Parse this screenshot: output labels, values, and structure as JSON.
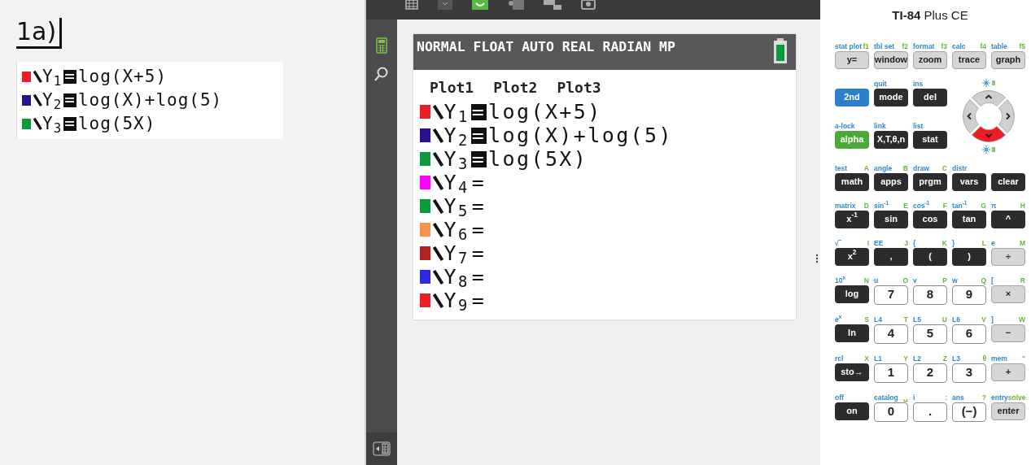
{
  "notes": {
    "heading": "1a)",
    "equations": [
      {
        "color": "#ee1c24",
        "label": "Y$_{1}$",
        "equals": "=",
        "selected": true,
        "expression": "log(X+5)"
      },
      {
        "color": "#2a0f90",
        "label": "Y$_{2}$",
        "equals": "=",
        "selected": true,
        "expression": "log(X)+log(5)"
      },
      {
        "color": "#0b9a3b",
        "label": "Y$_{3}$",
        "equals": "=",
        "selected": true,
        "expression": "log(5X)"
      }
    ]
  },
  "screen": {
    "status": "NORMAL FLOAT AUTO REAL RADIAN MP",
    "plots": [
      "Plot1",
      "Plot2",
      "Plot3"
    ],
    "functions": [
      {
        "color": "#ee1c24",
        "label": "Y$_{1}$",
        "equals": "=",
        "selected": true,
        "expression": "log(X+5)"
      },
      {
        "color": "#2a0f90",
        "label": "Y$_{2}$",
        "equals": "=",
        "selected": true,
        "expression": "log(X)+log(5)"
      },
      {
        "color": "#0b9a3b",
        "label": "Y$_{3}$",
        "equals": "=",
        "selected": true,
        "expression": "log(5X)"
      },
      {
        "color": "#ff00ff",
        "label": "Y$_{4}$",
        "equals": "=",
        "selected": false
      },
      {
        "color": "#0b9a3b",
        "label": "Y$_{5}$",
        "equals": "=",
        "selected": false
      },
      {
        "color": "#f7924a",
        "label": "Y$_{6}$",
        "equals": "=",
        "selected": false
      },
      {
        "color": "#b22222",
        "label": "Y$_{7}$",
        "equals": "=",
        "selected": false
      },
      {
        "color": "#2a2ae0",
        "label": "Y$_{8}$",
        "equals": "=",
        "selected": false
      },
      {
        "color": "#ee1c24",
        "label": "Y$_{9}$",
        "equals": "=",
        "selected": false
      }
    ]
  },
  "keypad": {
    "title": "**TI-84** Plus CE",
    "dpad": [
      {
        "kind": "up",
        "pressed": false
      },
      {
        "kind": "left",
        "pressed": false
      },
      {
        "kind": "right",
        "pressed": false
      },
      {
        "kind": "down",
        "pressed": true
      }
    ],
    "keys": [
      {
        "second": "stat plot",
        "alpha": "f1",
        "label": "y=",
        "kind": "gray"
      },
      {
        "second": "tbl set",
        "alpha": "f2",
        "label": "window",
        "kind": "gray"
      },
      {
        "second": "format",
        "alpha": "f3",
        "label": "zoom",
        "kind": "gray"
      },
      {
        "second": "calc",
        "alpha": "f4",
        "label": "trace",
        "kind": "gray"
      },
      {
        "second": "table",
        "alpha": "f5",
        "label": "graph",
        "kind": "gray"
      },
      {
        "label": "2nd",
        "kind": "blue"
      },
      {
        "second": "quit",
        "label": "mode",
        "kind": "dark"
      },
      {
        "second": "ins",
        "label": "del",
        "kind": "dark"
      },
      {
        "second": "a-lock",
        "label": "alpha",
        "kind": "green"
      },
      {
        "second": "link",
        "label": "X,T,θ,n",
        "kind": "dark"
      },
      {
        "second": "list",
        "label": "stat",
        "kind": "dark"
      },
      {
        "second": "test",
        "alpha": "A",
        "label": "math",
        "kind": "dark"
      },
      {
        "second": "angle",
        "alpha": "B",
        "label": "apps",
        "kind": "dark"
      },
      {
        "second": "draw",
        "alpha": "C",
        "label": "prgm",
        "kind": "dark"
      },
      {
        "second": "distr",
        "label": "vars",
        "kind": "dark"
      },
      {
        "label": "clear",
        "kind": "dark"
      },
      {
        "second": "matrix",
        "alpha": "D",
        "label": "x$^{-1}$",
        "kind": "dark"
      },
      {
        "second": "sin$^{-1}$",
        "alpha": "E",
        "label": "sin",
        "kind": "dark"
      },
      {
        "second": "cos$^{-1}$",
        "alpha": "F",
        "label": "cos",
        "kind": "dark"
      },
      {
        "second": "tan$^{-1}$",
        "alpha": "G",
        "label": "tan",
        "kind": "dark"
      },
      {
        "second": "π",
        "alpha": "H",
        "label": "^",
        "kind": "dark"
      },
      {
        "second": "√‾",
        "alpha": "I",
        "label": "x$^{2}$",
        "kind": "dark"
      },
      {
        "second": "EE",
        "alpha": "J",
        "label": ",",
        "kind": "dark"
      },
      {
        "second": "{",
        "alpha": "K",
        "label": "(",
        "kind": "dark"
      },
      {
        "second": "}",
        "alpha": "L",
        "label": ")",
        "kind": "dark"
      },
      {
        "second": "e",
        "alpha": "M",
        "label": "÷",
        "kind": "gray"
      },
      {
        "second": "10$^{x}$",
        "alpha": "N",
        "label": "log",
        "kind": "dark"
      },
      {
        "second": "u",
        "alpha": "O",
        "label": "7",
        "kind": "white"
      },
      {
        "second": "v",
        "alpha": "P",
        "label": "8",
        "kind": "white"
      },
      {
        "second": "w",
        "alpha": "Q",
        "label": "9",
        "kind": "white"
      },
      {
        "second": "[",
        "alpha": "R",
        "label": "×",
        "kind": "gray"
      },
      {
        "second": "e$^{x}$",
        "alpha": "S",
        "label": "ln",
        "kind": "dark"
      },
      {
        "second": "L4",
        "alpha": "T",
        "label": "4",
        "kind": "white"
      },
      {
        "second": "L5",
        "alpha": "U",
        "label": "5",
        "kind": "white"
      },
      {
        "second": "L6",
        "alpha": "V",
        "label": "6",
        "kind": "white"
      },
      {
        "second": "]",
        "alpha": "W",
        "label": "−",
        "kind": "gray"
      },
      {
        "second": "rcl",
        "alpha": "X",
        "label": "sto→",
        "kind": "dark"
      },
      {
        "second": "L1",
        "alpha": "Y",
        "label": "1",
        "kind": "white"
      },
      {
        "second": "L2",
        "alpha": "Z",
        "label": "2",
        "kind": "white"
      },
      {
        "second": "L3",
        "alpha": "θ",
        "label": "3",
        "kind": "white"
      },
      {
        "second": "mem",
        "alpha": "\"",
        "label": "+",
        "kind": "gray"
      },
      {
        "second": "off",
        "label": "on",
        "kind": "dark"
      },
      {
        "second": "catalog",
        "alpha": "␣",
        "label": "0",
        "kind": "white"
      },
      {
        "second": "i",
        "alpha": ":",
        "label": ".",
        "kind": "white"
      },
      {
        "second": "ans",
        "alpha": "?",
        "label": "(−)",
        "kind": "white"
      },
      {
        "second": "entry",
        "alpha": "solve",
        "label": "enter",
        "kind": "gray"
      }
    ]
  }
}
